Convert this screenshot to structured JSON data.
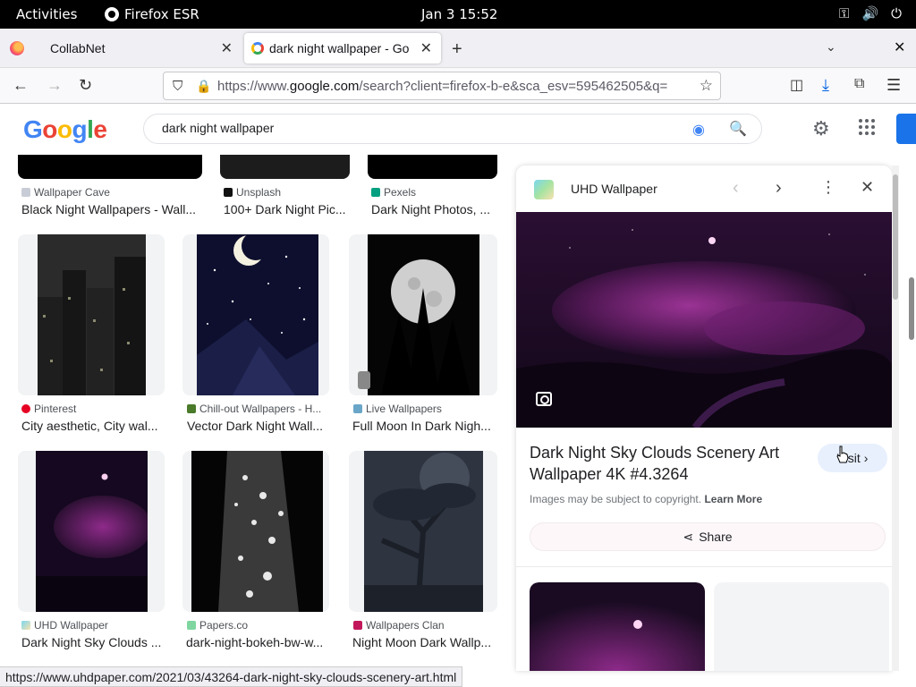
{
  "system": {
    "activities": "Activities",
    "app": "Firefox ESR",
    "clock": "Jan 3  15:52"
  },
  "tabs": [
    {
      "title": "CollabNet"
    },
    {
      "title": "dark night wallpaper - Go"
    }
  ],
  "nav": {
    "url_prefix": "https://www.",
    "url_domain": "google.com",
    "url_rest": "/search?client=firefox-b-e&sca_esv=595462505&q="
  },
  "google": {
    "logo": "Google",
    "query": "dark night wallpaper"
  },
  "results": {
    "top_row": [
      {
        "source": "Wallpaper Cave",
        "title": "Black Night Wallpapers - Wall..."
      },
      {
        "source": "Unsplash",
        "title": "100+ Dark Night Pic..."
      },
      {
        "source": "Pexels",
        "title": "Dark Night Photos, ..."
      }
    ],
    "mid_row": [
      {
        "source": "Pinterest",
        "title": "City aesthetic, City wal..."
      },
      {
        "source": "Chill-out Wallpapers - H...",
        "title": "Vector Dark Night Wall..."
      },
      {
        "source": "Live Wallpapers",
        "title": "Full Moon In Dark Nigh..."
      }
    ],
    "bottom_row": [
      {
        "source": "UHD Wallpaper",
        "title": "Dark Night Sky Clouds ..."
      },
      {
        "source": "Papers.co",
        "title": "dark-night-bokeh-bw-w..."
      },
      {
        "source": "Wallpapers Clan",
        "title": "Night Moon Dark Wallp..."
      }
    ]
  },
  "panel": {
    "source": "UHD Wallpaper",
    "title": "Dark Night Sky Clouds Scenery Art Wallpaper 4K #4.3264",
    "visit": "Visit",
    "copyright": "Images may be subject to copyright.",
    "learn_more": "Learn More",
    "share": "Share"
  },
  "status_url": "https://www.uhdpaper.com/2021/03/43264-dark-night-sky-clouds-scenery-art.html",
  "colors": {
    "google_blue": "#4285f4",
    "google_red": "#ea4335",
    "google_yellow": "#fbbc05",
    "google_green": "#34a853"
  }
}
